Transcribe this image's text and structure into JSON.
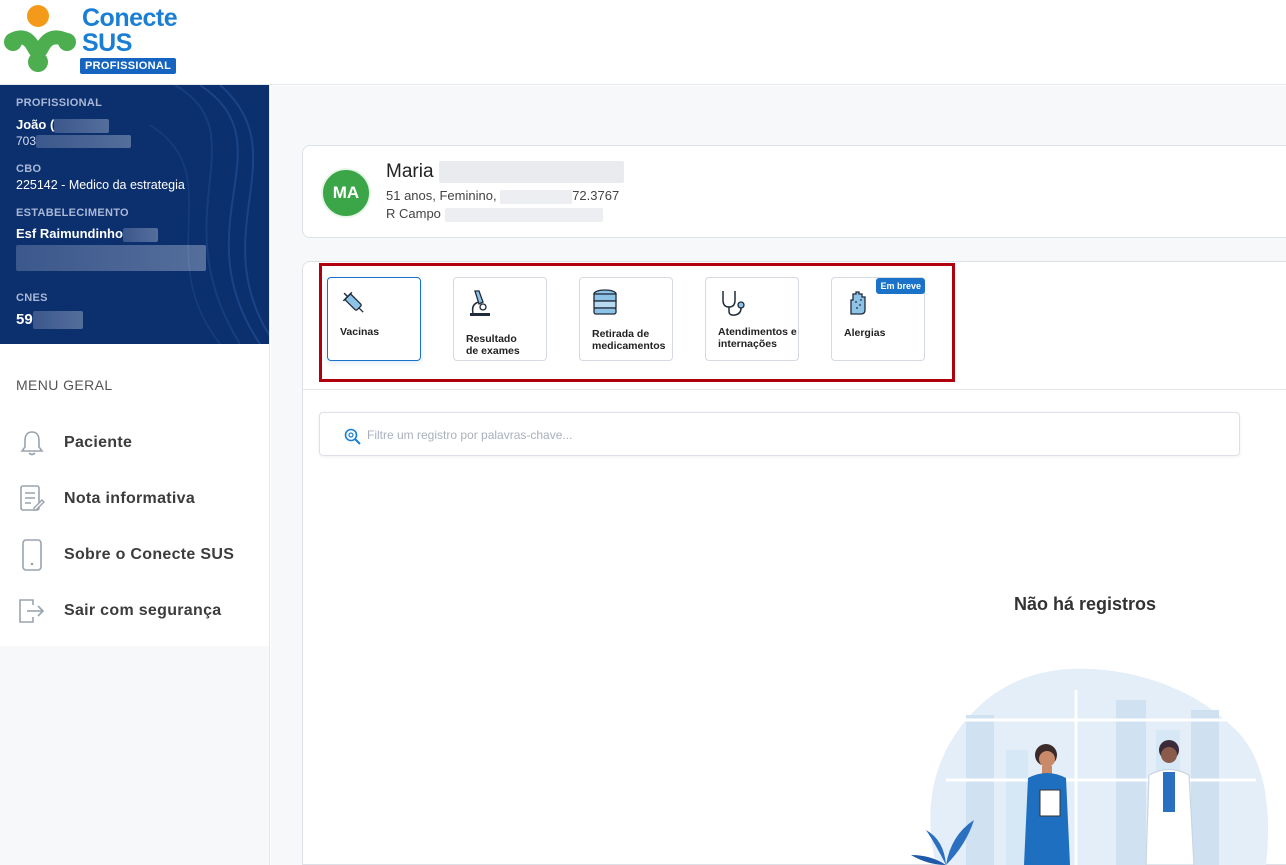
{
  "header": {
    "brand_line1": "Conecte",
    "brand_line2": "SUS",
    "brand_badge": "PROFISSIONAL"
  },
  "profile": {
    "professional_label": "PROFISSIONAL",
    "professional_name": "João (",
    "professional_id": "703",
    "cbo_label": "CBO",
    "cbo_value": "225142 - Medico da estrategia",
    "establishment_label": "ESTABELECIMENTO",
    "establishment_value": "Esf Raimundinho",
    "cnes_label": "CNES",
    "cnes_value": "59"
  },
  "menu": {
    "title": "MENU GERAL",
    "items": [
      {
        "label": "Paciente",
        "icon": "bell-icon"
      },
      {
        "label": "Nota informativa",
        "icon": "document-edit-icon"
      },
      {
        "label": "Sobre o Conecte SUS",
        "icon": "phone-icon"
      },
      {
        "label": "Sair com segurança",
        "icon": "logout-icon"
      }
    ]
  },
  "patient": {
    "initials": "MA",
    "name": "Maria",
    "age_gender": "51 anos,  Feminino,",
    "phone_suffix": "72.3767",
    "address": "R Campo"
  },
  "tiles": [
    {
      "label_line1": "Vacinas",
      "label_line2": "",
      "icon": "syringe-icon",
      "active": true
    },
    {
      "label_line1": "Resultado",
      "label_line2": "de exames",
      "icon": "microscope-icon",
      "active": false
    },
    {
      "label_line1": "Retirada de",
      "label_line2": "medicamentos",
      "icon": "medicine-stack-icon",
      "active": false
    },
    {
      "label_line1": "Atendimentos e",
      "label_line2": "internações",
      "icon": "stethoscope-icon",
      "active": false
    },
    {
      "label_line1": "Alergias",
      "label_line2": "",
      "icon": "allergy-hand-icon",
      "active": false,
      "badge": "Em breve"
    }
  ],
  "search": {
    "placeholder": "Filtre um registro por palavras-chave...",
    "value": ""
  },
  "empty_state": {
    "title": "Não há registros"
  },
  "colors": {
    "primary_blue": "#1a73c8",
    "sidebar_navy": "#0c2f6e",
    "avatar_green": "#3aa648",
    "highlight_red": "#b0000e"
  }
}
